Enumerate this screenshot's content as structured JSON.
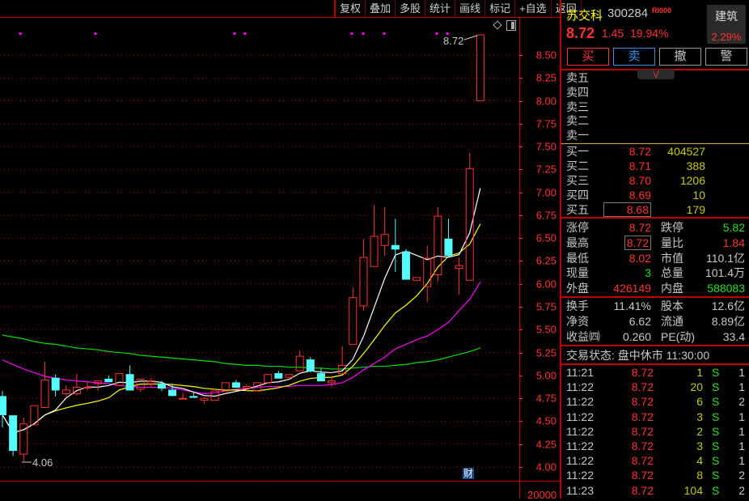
{
  "toolbar": {
    "items": [
      "复权",
      "叠加",
      "多股",
      "统计",
      "画线",
      "标记",
      "+自选",
      "返回"
    ]
  },
  "stock": {
    "name": "苏交科",
    "code": "300284",
    "tag": "RI000",
    "price": "8.72",
    "change": "1.45",
    "change_pct": "19.94%",
    "industry": "建筑",
    "industry_pct": "2.29%"
  },
  "actions": {
    "buy": "买",
    "sell": "卖",
    "cancel": "撤",
    "alert": "警"
  },
  "sell_orders": [
    {
      "label": "卖五"
    },
    {
      "label": "卖四"
    },
    {
      "label": "卖三"
    },
    {
      "label": "卖二"
    },
    {
      "label": "卖一"
    }
  ],
  "buy_orders": [
    {
      "label": "买一",
      "price": "8.72",
      "vol": "404527"
    },
    {
      "label": "买二",
      "price": "8.71",
      "vol": "388"
    },
    {
      "label": "买三",
      "price": "8.70",
      "vol": "1206"
    },
    {
      "label": "买四",
      "price": "8.69",
      "vol": "10"
    },
    {
      "label": "买五",
      "price": "8.68",
      "vol": "179"
    }
  ],
  "stats": [
    {
      "l1": "涨停",
      "v1": "8.72",
      "c1": "red",
      "l2": "跌停",
      "v2": "5.82",
      "c2": "grn"
    },
    {
      "l1": "最高",
      "v1": "8.72",
      "c1": "red",
      "l2": "量比",
      "v2": "1.84",
      "c2": "red"
    },
    {
      "l1": "最低",
      "v1": "8.02",
      "c1": "red",
      "l2": "市值",
      "v2": "110.1亿",
      "c2": "wht"
    },
    {
      "l1": "现量",
      "v1": "3",
      "c1": "grn",
      "l2": "总量",
      "v2": "101.4万",
      "c2": "wht"
    },
    {
      "l1": "外盘",
      "v1": "426149",
      "c1": "red",
      "l2": "内盘",
      "v2": "588083",
      "c2": "grn"
    }
  ],
  "stats2": [
    {
      "l1": "换手",
      "v1": "11.41%",
      "l2": "股本",
      "v2": "12.6亿"
    },
    {
      "l1": "净资",
      "v1": "6.62",
      "l2": "流通",
      "v2": "8.89亿"
    },
    {
      "l1": "收益㈣",
      "v1": "0.260",
      "l2": "PE(动)",
      "v2": "33.4"
    }
  ],
  "status": "交易状态: 盘中休市 11:30:00",
  "trades": [
    {
      "t": "11:21",
      "p": "8.72",
      "v": "1",
      "s": "S",
      "n": "1"
    },
    {
      "t": "11:22",
      "p": "8.72",
      "v": "20",
      "s": "S",
      "n": "1"
    },
    {
      "t": "11:22",
      "p": "8.72",
      "v": "6",
      "s": "S",
      "n": "2"
    },
    {
      "t": "11:22",
      "p": "8.72",
      "v": "3",
      "s": "S",
      "n": "1"
    },
    {
      "t": "11:22",
      "p": "8.72",
      "v": "2",
      "s": "S",
      "n": "1"
    },
    {
      "t": "11:22",
      "p": "8.72",
      "v": "3",
      "s": "S",
      "n": "1"
    },
    {
      "t": "11:22",
      "p": "8.72",
      "v": "4",
      "s": "S",
      "n": "1"
    },
    {
      "t": "11:22",
      "p": "8.72",
      "v": "8",
      "s": "S",
      "n": "2"
    },
    {
      "t": "11:23",
      "p": "8.72",
      "v": "104",
      "s": "S",
      "n": "2"
    }
  ],
  "chart_data": {
    "type": "candlestick",
    "yticks": [
      "8.50",
      "8.25",
      "8.00",
      "7.75",
      "7.50",
      "7.25",
      "7.00",
      "6.75",
      "6.50",
      "6.25",
      "6.00",
      "5.75",
      "5.50",
      "5.25",
      "5.00",
      "4.75",
      "4.50",
      "4.25",
      "4.00"
    ],
    "ylim": [
      3.97,
      8.95
    ],
    "volume_axis_label": "20000",
    "high_label": "8.72",
    "low_label": "4.06",
    "event_marker": "财",
    "colors": {
      "up": "#ff3232",
      "down": "#54fcfc",
      "ma5": "#ffffff",
      "ma10": "#ffff00",
      "ma20": "#ff00ff",
      "ma60": "#00e000"
    },
    "ohlc": [
      [
        4.77,
        4.83,
        4.43,
        4.57
      ],
      [
        4.56,
        4.56,
        4.12,
        4.18
      ],
      [
        4.14,
        4.54,
        4.06,
        4.47
      ],
      [
        4.46,
        4.67,
        4.46,
        4.67
      ],
      [
        4.65,
        5.15,
        4.65,
        4.95
      ],
      [
        4.97,
        5.01,
        4.77,
        4.84
      ],
      [
        4.8,
        4.89,
        4.77,
        4.84
      ],
      [
        4.8,
        5.02,
        4.78,
        4.87
      ],
      [
        4.87,
        4.93,
        4.83,
        4.87
      ],
      [
        4.91,
        4.94,
        4.83,
        4.94
      ],
      [
        4.96,
        5.0,
        4.93,
        4.93
      ],
      [
        4.89,
        5.02,
        4.89,
        5.02
      ],
      [
        5.01,
        5.11,
        4.84,
        4.84
      ],
      [
        4.85,
        4.96,
        4.82,
        4.96
      ],
      [
        4.91,
        4.97,
        4.87,
        4.94
      ],
      [
        4.91,
        4.94,
        4.83,
        4.86
      ],
      [
        4.84,
        4.91,
        4.77,
        4.78
      ],
      [
        4.75,
        4.81,
        4.75,
        4.75
      ],
      [
        4.77,
        4.82,
        4.76,
        4.76
      ],
      [
        4.73,
        4.76,
        4.69,
        4.75
      ],
      [
        4.73,
        4.83,
        4.73,
        4.83
      ],
      [
        4.83,
        4.92,
        4.83,
        4.92
      ],
      [
        4.92,
        4.95,
        4.87,
        4.87
      ],
      [
        4.86,
        4.9,
        4.83,
        4.88
      ],
      [
        4.83,
        4.92,
        4.83,
        4.92
      ],
      [
        4.92,
        5.01,
        4.92,
        5.01
      ],
      [
        5.02,
        5.05,
        4.97,
        4.97
      ],
      [
        4.98,
        5.01,
        4.98,
        5.01
      ],
      [
        5.05,
        5.27,
        5.05,
        5.21
      ],
      [
        5.17,
        5.2,
        5.03,
        5.05
      ],
      [
        5.02,
        5.08,
        4.94,
        4.94
      ],
      [
        4.92,
        4.98,
        4.87,
        4.94
      ],
      [
        5.02,
        5.32,
        5.02,
        5.11
      ],
      [
        5.34,
        5.96,
        5.34,
        5.85
      ],
      [
        5.76,
        6.49,
        5.71,
        6.29
      ],
      [
        6.19,
        6.86,
        6.19,
        6.52
      ],
      [
        6.42,
        6.84,
        6.31,
        6.54
      ],
      [
        6.42,
        6.71,
        6.13,
        6.38
      ],
      [
        6.35,
        6.38,
        6.05,
        6.05
      ],
      [
        6.04,
        6.07,
        6.04,
        6.07
      ],
      [
        5.97,
        6.42,
        5.8,
        6.28
      ],
      [
        6.1,
        6.84,
        6.02,
        6.74
      ],
      [
        6.49,
        6.71,
        6.29,
        6.31
      ],
      [
        6.17,
        6.29,
        5.88,
        6.2
      ],
      [
        6.04,
        7.43,
        6.04,
        7.26
      ],
      [
        8.0,
        8.72,
        8.0,
        8.72
      ]
    ],
    "ma20": [
      5.17,
      5.12,
      5.07,
      5.03,
      4.99,
      4.97,
      4.95,
      4.94,
      4.93,
      4.92,
      4.91,
      4.89,
      4.88,
      4.87,
      4.87,
      4.87,
      4.86,
      4.84,
      4.82,
      4.8,
      4.81,
      4.83,
      4.85,
      4.86,
      4.87,
      4.88,
      4.88,
      4.88,
      4.89,
      4.89,
      4.89,
      4.9,
      4.92,
      4.98,
      5.06,
      5.13,
      5.2,
      5.29,
      5.34,
      5.39,
      5.43,
      5.5,
      5.58,
      5.71,
      5.83,
      6.02
    ],
    "ma60": [
      5.44,
      5.42,
      5.4,
      5.37,
      5.35,
      5.34,
      5.32,
      5.3,
      5.29,
      5.28,
      5.26,
      5.25,
      5.24,
      5.22,
      5.21,
      5.2,
      5.19,
      5.18,
      5.17,
      5.16,
      5.15,
      5.13,
      5.12,
      5.11,
      5.11,
      5.1,
      5.1,
      5.09,
      5.09,
      5.08,
      5.08,
      5.07,
      5.07,
      5.08,
      5.09,
      5.1,
      5.1,
      5.11,
      5.12,
      5.14,
      5.15,
      5.17,
      5.2,
      5.23,
      5.26,
      5.3
    ]
  }
}
